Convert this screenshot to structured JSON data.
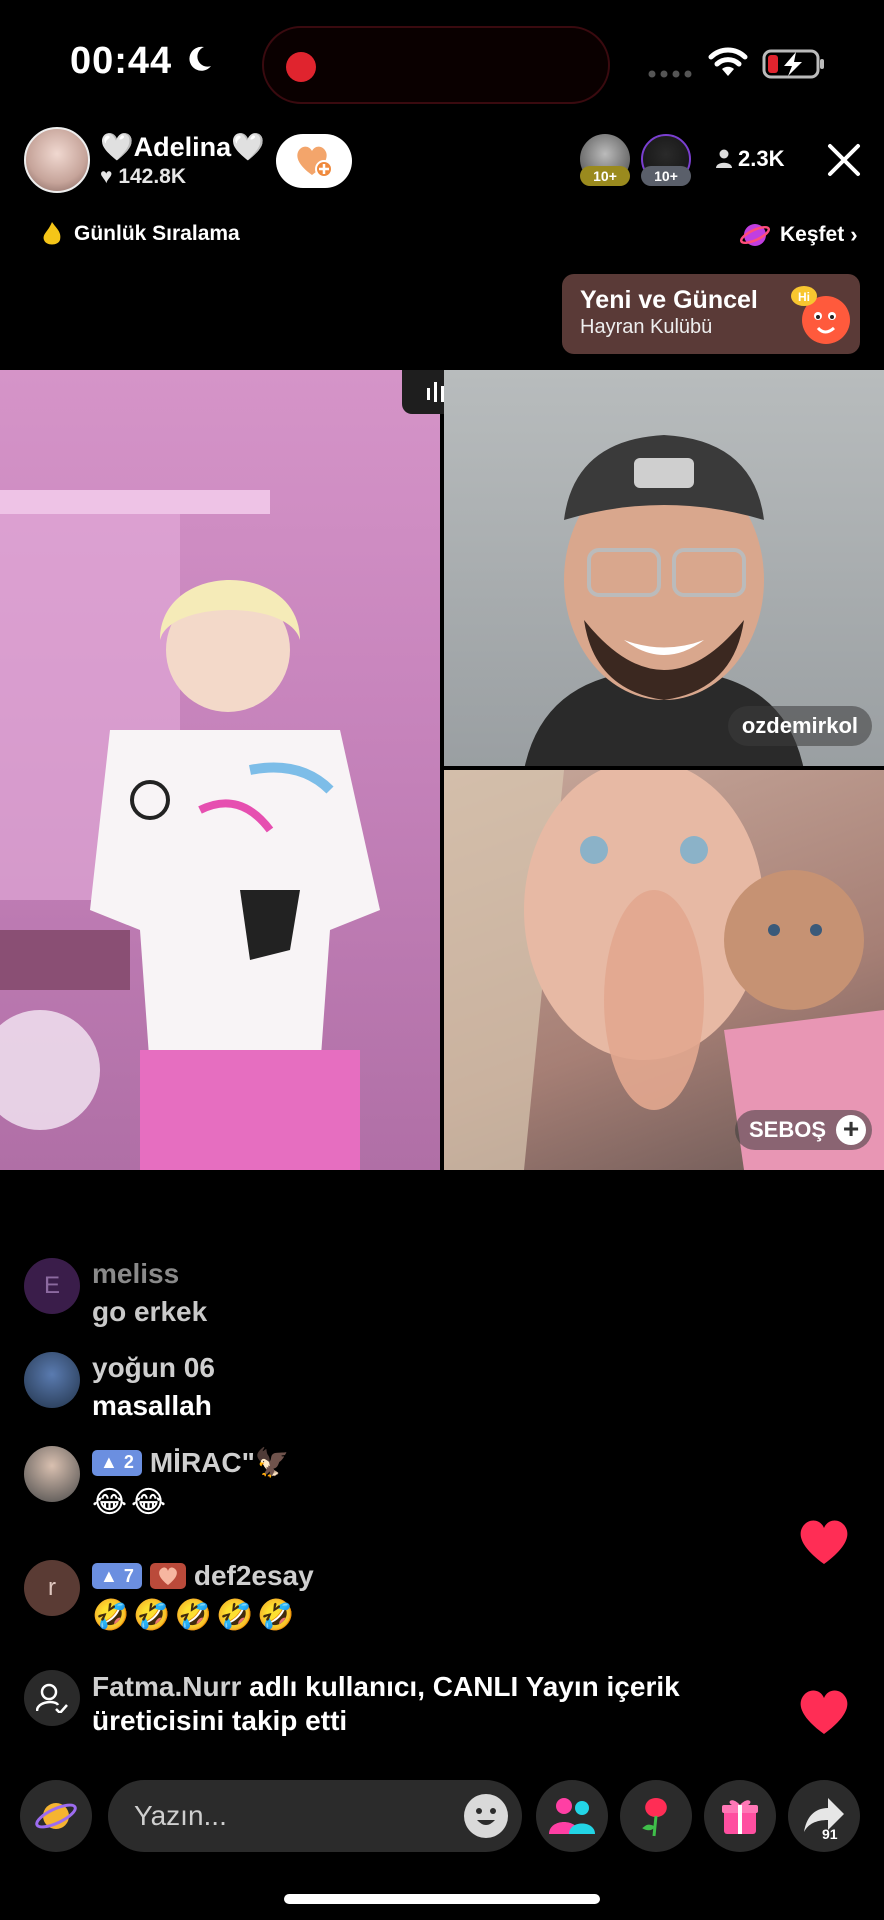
{
  "status_bar": {
    "time": "00:44",
    "icons": [
      "moon-icon",
      "wifi-icon",
      "battery-charging-icon"
    ]
  },
  "host": {
    "name": "🤍Adelina🤍",
    "likes": "142.8K"
  },
  "viewers": {
    "badges": [
      "10+",
      "10+"
    ],
    "count": "2.3K"
  },
  "sub_header": {
    "ranking_label": "Günlük Sıralama",
    "explore_label": "Keşfet"
  },
  "fan_club_banner": {
    "title": "Yeni ve Güncel",
    "subtitle": "Hayran Kulübü"
  },
  "guests": [
    {
      "name": "ozdemirkol"
    },
    {
      "name": "SEBOŞ"
    }
  ],
  "chat": [
    {
      "user": "meliss",
      "avatar_letter": "E",
      "text": "go erkek"
    },
    {
      "user": "yoğun 06",
      "text": "masallah"
    },
    {
      "user": "MİRAC\"🦅",
      "level": "2",
      "text": "😂😂"
    },
    {
      "user": "def2esay",
      "avatar_letter": "r",
      "level": "7",
      "text": "🤣🤣🤣🤣🤣"
    }
  ],
  "follow_notice": {
    "user": "Fatma.Nurr",
    "text": " adlı kullanıcı, CANLI Yayın içerik üreticisini takip etti"
  },
  "composer": {
    "placeholder": "Yazın..."
  },
  "share": {
    "count": "91"
  },
  "colors": {
    "accent_red": "#e0242e",
    "heart": "#ff2d55",
    "level_badge": "#6b8fe0"
  }
}
